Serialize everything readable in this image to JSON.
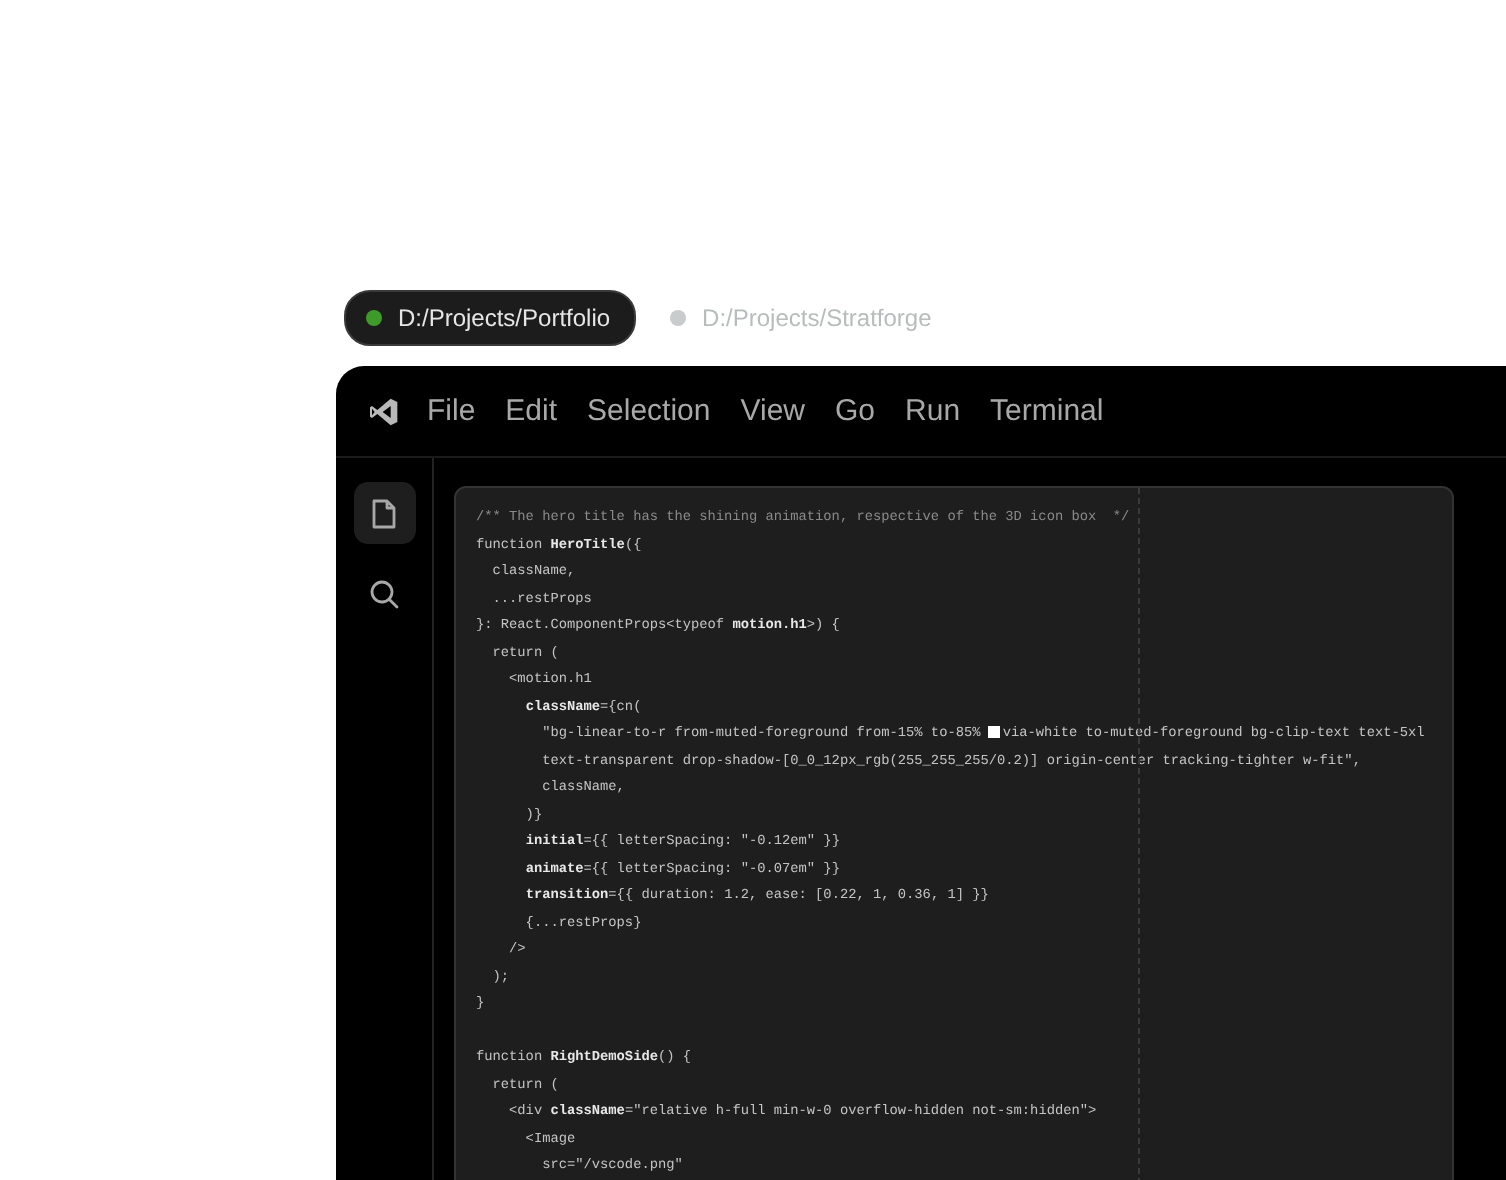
{
  "workspace_tabs": [
    {
      "label": "D:/Projects/Portfolio",
      "selected": true
    },
    {
      "label": "D:/Projects/Stratforge",
      "selected": false
    }
  ],
  "menu": [
    "File",
    "Edit",
    "Selection",
    "View",
    "Go",
    "Run",
    "Terminal"
  ],
  "activity_bar": [
    {
      "kind": "files",
      "selected": true
    },
    {
      "kind": "search",
      "selected": false
    }
  ],
  "code_lines": [
    {
      "kind": "comment",
      "text": "/** The hero title has the shining animation, respective of the 3D icon box  */"
    },
    {
      "kind": "code",
      "text": "function **HeroTitle**({"
    },
    {
      "kind": "code",
      "text": "  className,"
    },
    {
      "kind": "code",
      "text": "  ...restProps"
    },
    {
      "kind": "code",
      "text": "}: React.ComponentProps<typeof **motion.h1**>) {"
    },
    {
      "kind": "code",
      "text": "  return ("
    },
    {
      "kind": "code",
      "text": "    <motion.h1"
    },
    {
      "kind": "code",
      "text": "      **className**={cn("
    },
    {
      "kind": "swatch",
      "before": "        \"bg-linear-to-r from-muted-foreground from-15% to-85% ",
      "after": "via-white to-muted-foreground bg-clip-text text-5xl"
    },
    {
      "kind": "code",
      "text": "        text-transparent drop-shadow-[0_0_12px_rgb(255_255_255/0.2)] origin-center tracking-tighter w-fit\","
    },
    {
      "kind": "code",
      "text": "        className,"
    },
    {
      "kind": "code",
      "text": "      )}"
    },
    {
      "kind": "code",
      "text": "      **initial**={{ letterSpacing: \"-0.12em\" }}"
    },
    {
      "kind": "code",
      "text": "      **animate**={{ letterSpacing: \"-0.07em\" }}"
    },
    {
      "kind": "code",
      "text": "      **transition**={{ duration: 1.2, ease: [0.22, 1, 0.36, 1] }}"
    },
    {
      "kind": "code",
      "text": "      {...restProps}"
    },
    {
      "kind": "code",
      "text": "    />"
    },
    {
      "kind": "code",
      "text": "  );"
    },
    {
      "kind": "code",
      "text": "}"
    },
    {
      "kind": "blank"
    },
    {
      "kind": "code",
      "text": "function **RightDemoSide**() {"
    },
    {
      "kind": "code",
      "text": "  return ("
    },
    {
      "kind": "code",
      "text": "    <div **className**=\"relative h-full min-w-0 overflow-hidden not-sm:hidden\">"
    },
    {
      "kind": "code",
      "text": "      <Image"
    },
    {
      "kind": "code",
      "text": "        src=\"/vscode.png\""
    }
  ]
}
